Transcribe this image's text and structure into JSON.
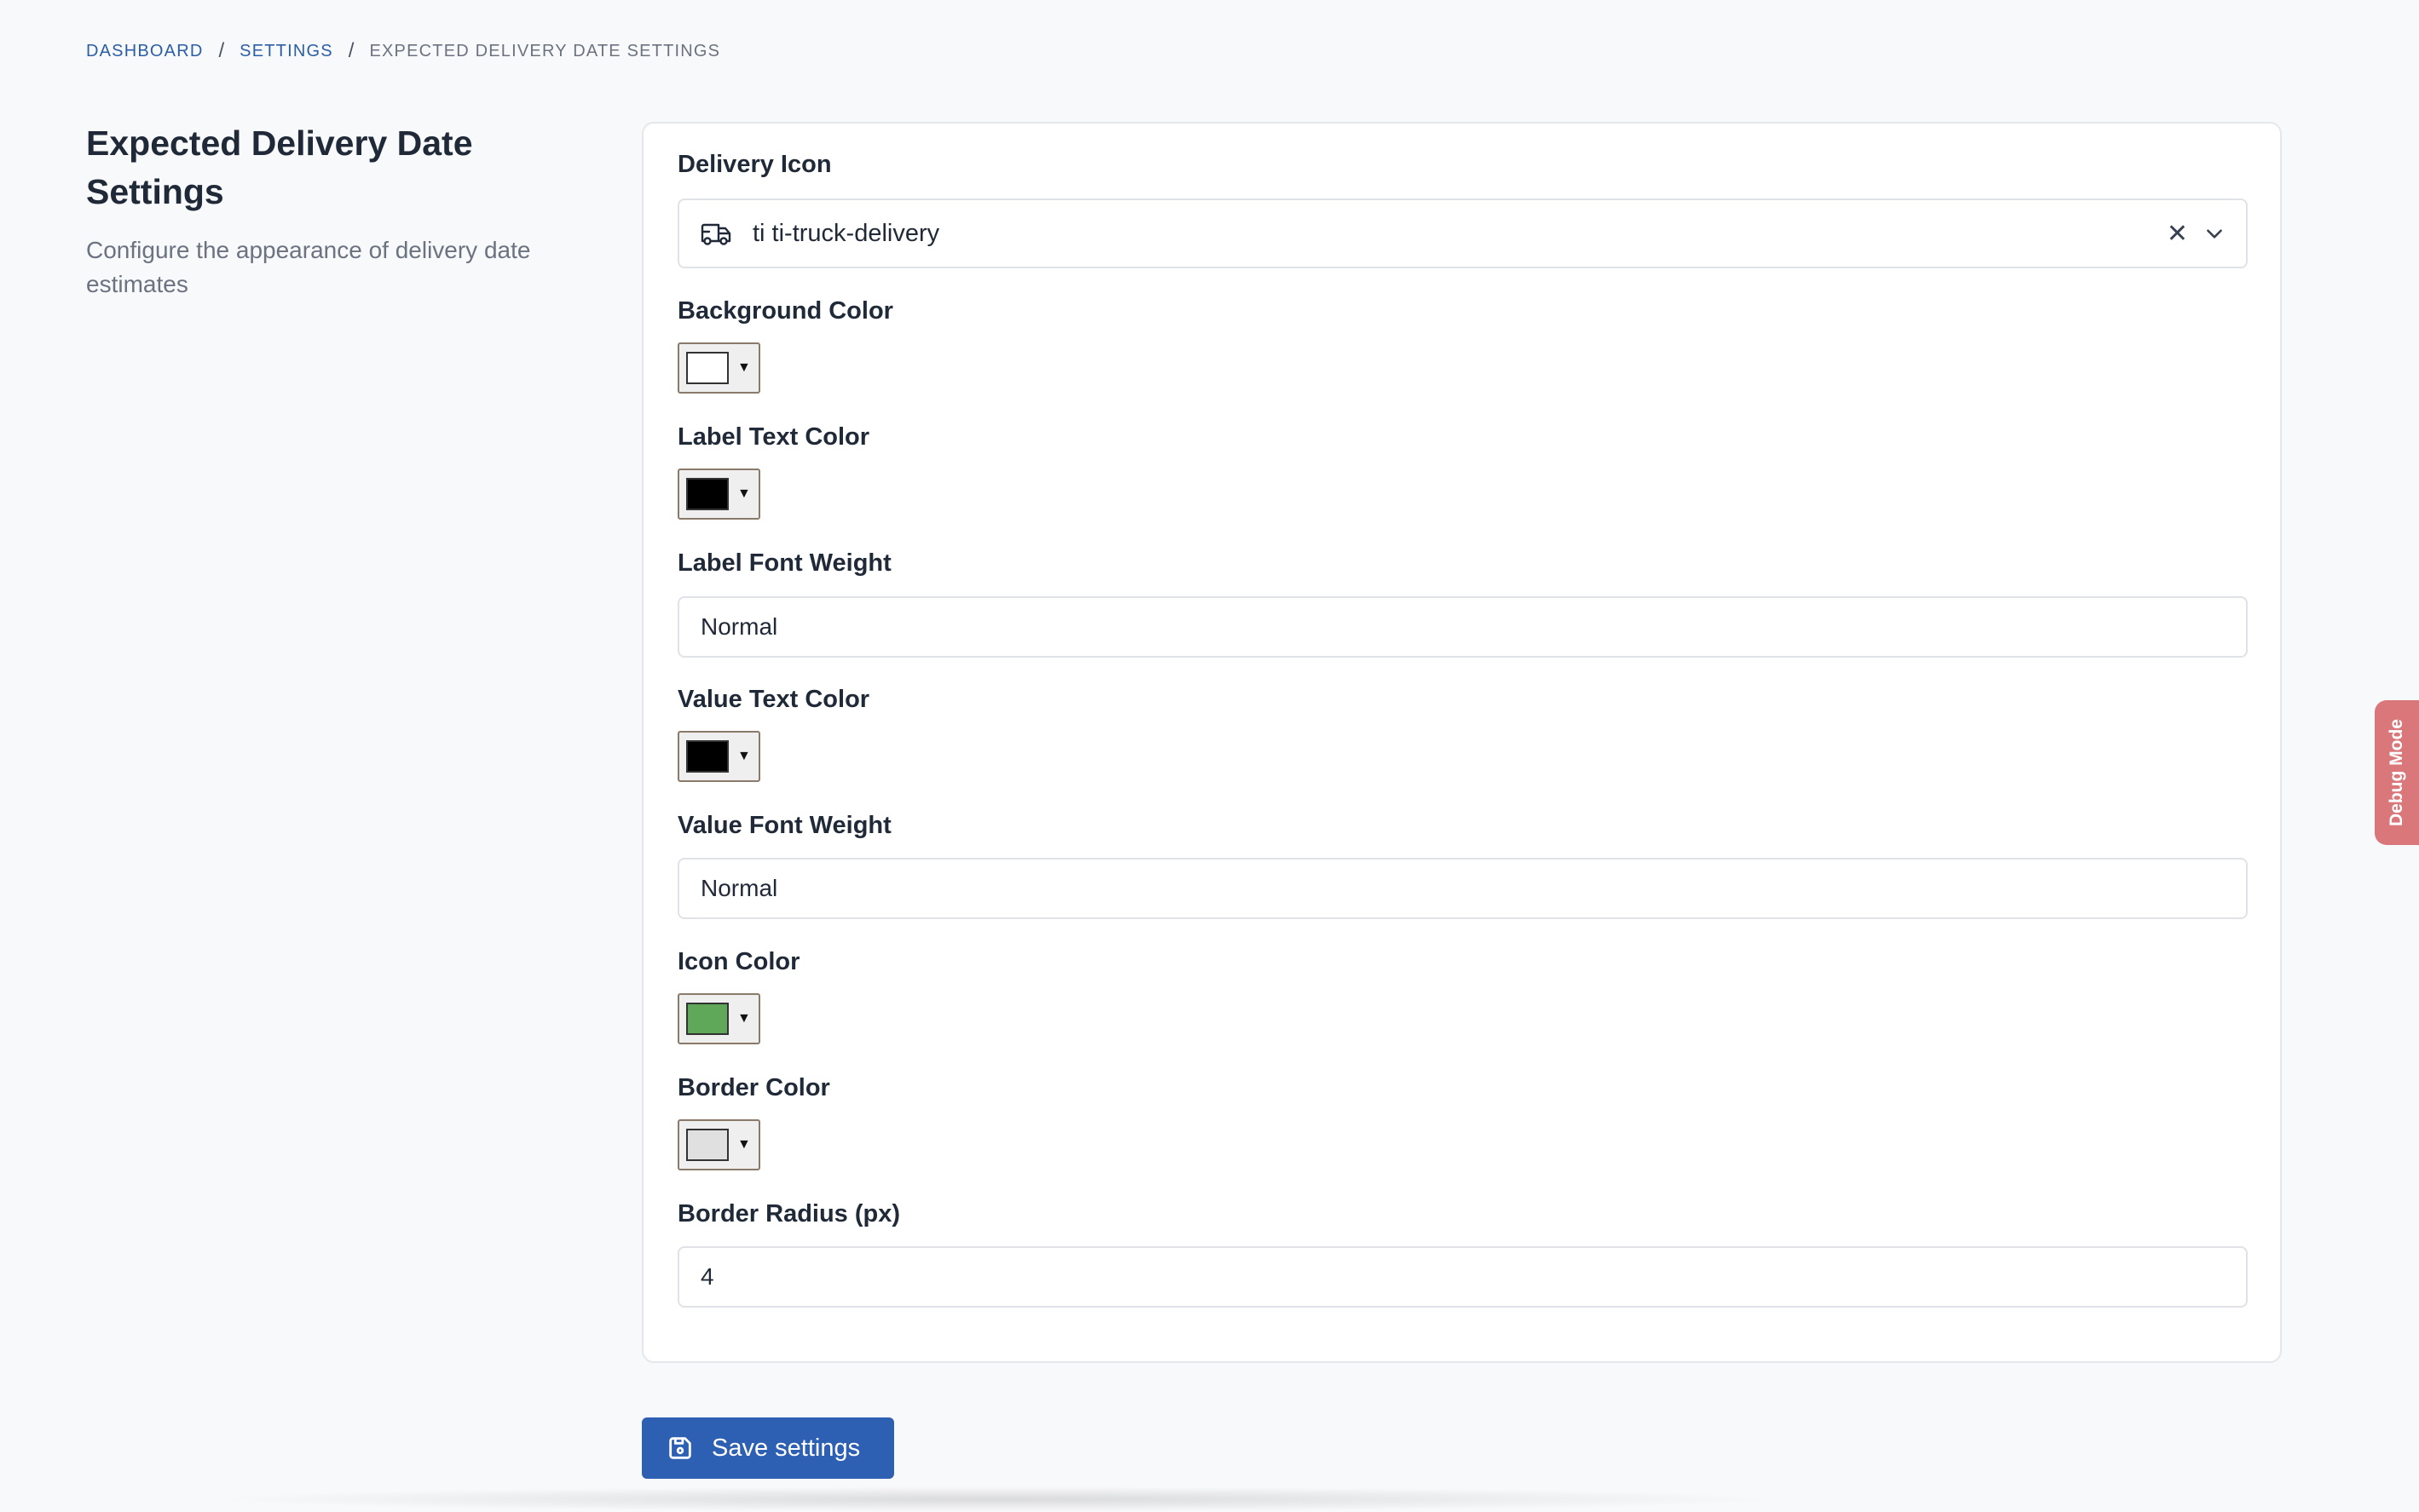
{
  "breadcrumb": {
    "items": [
      "DASHBOARD",
      "SETTINGS",
      "EXPECTED DELIVERY DATE SETTINGS"
    ],
    "separator": "/"
  },
  "page": {
    "title": "Expected Delivery Date Settings",
    "description": "Configure the appearance of delivery date estimates"
  },
  "form": {
    "delivery_icon": {
      "label": "Delivery Icon",
      "value": "ti ti-truck-delivery",
      "icon": "truck-delivery-icon"
    },
    "background_color": {
      "label": "Background Color",
      "color": "#ffffff"
    },
    "label_text_color": {
      "label": "Label Text Color",
      "color": "#000000"
    },
    "label_font_weight": {
      "label": "Label Font Weight",
      "value": "Normal"
    },
    "value_text_color": {
      "label": "Value Text Color",
      "color": "#000000"
    },
    "value_font_weight": {
      "label": "Value Font Weight",
      "value": "Normal"
    },
    "icon_color": {
      "label": "Icon Color",
      "color": "#5fa85a"
    },
    "border_color": {
      "label": "Border Color",
      "color": "#e0e0e0"
    },
    "border_radius": {
      "label": "Border Radius (px)",
      "value": "4"
    }
  },
  "actions": {
    "save_label": "Save settings"
  },
  "debug_tab": {
    "label": "Debug Mode"
  },
  "colors": {
    "primary": "#2d5fb3",
    "link": "#2b5ea7",
    "debug": "#d9777a"
  }
}
